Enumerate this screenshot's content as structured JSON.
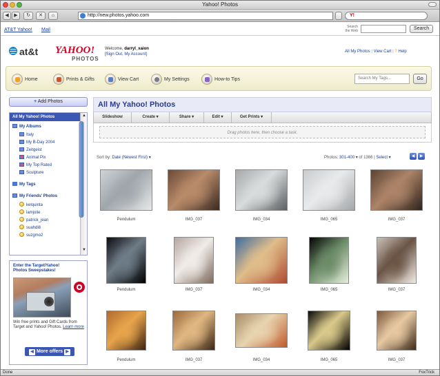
{
  "browser": {
    "window_title": "Yahoo! Photos",
    "url": "http://new.photos.yahoo.com",
    "nav_buttons": [
      "◀",
      "▶",
      "↻",
      "✕",
      "⌂"
    ],
    "search_brand": "Y!",
    "status_left": "Done",
    "status_right": "FoxTrick"
  },
  "toplinks": {
    "att_yahoo": "AT&T Yahoo!",
    "mail": "Mail",
    "search_web_label": "Search the Web",
    "search_button": "Search"
  },
  "header": {
    "att_text": "at&t",
    "yahoo_text": "YAHOO!",
    "photos_text": "PHOTOS",
    "welcome_prefix": "Welcome,",
    "username": "darryl_xaion",
    "signout": "[Sign Out, My Account]",
    "all_my_photos_link": "All My Photos",
    "view_cart_link": "View Cart",
    "help_link": "Help"
  },
  "nav": {
    "items": [
      {
        "label": "Home",
        "icon": "home-icon"
      },
      {
        "label": "Prints & Gifts",
        "icon": "gift-icon"
      },
      {
        "label": "View Cart",
        "icon": "cart-icon"
      },
      {
        "label": "My Settings",
        "icon": "settings-icon"
      },
      {
        "label": "How-to Tips",
        "icon": "tips-icon"
      }
    ],
    "tag_search_placeholder": "Search My Tags...",
    "go_button": "Go"
  },
  "sidebar": {
    "add_photos": "Add Photos",
    "header": "All My Yahoo! Photos",
    "my_albums": "My Albums",
    "albums": [
      "Italy",
      "My B-Day 2004",
      "Zeitgeist",
      "Animal Pix",
      "My Top Rated",
      "Sculpture"
    ],
    "my_tags": "My Tags",
    "my_friends": "My Friends' Photos",
    "friends": [
      "kelquinta",
      "lamjolie",
      "patrick_jean",
      "suahdi8",
      "suzgmo2"
    ]
  },
  "promo": {
    "title": "Enter the Target/Yahoo! Photos Sweepstakes!",
    "body": "Win free prints and Gift Cards from Target and Yahoo! Photos.",
    "learn_more": "Learn more",
    "more_offers": "More offers"
  },
  "main": {
    "title": "All My Yahoo! Photos",
    "actions": [
      "Slideshow",
      "Create ▾",
      "Share ▾",
      "Edit ▾",
      "Get Prints ▾"
    ],
    "drop_text": "Drag photos here, then choose a task.",
    "sort_label": "Sort by:",
    "sort_value": "Date (Newest First) ▾",
    "pager_prefix": "Photos:",
    "pager_range": "301-400 ▾",
    "pager_of": "of 1366 |",
    "select_label": "Select ▾",
    "prev": "◀",
    "next": "▶"
  },
  "photos": [
    {
      "caption": "Pendulum",
      "colors": [
        "#cfd3d6",
        "#9fa6ab",
        "#e7e7e7"
      ],
      "w": 76,
      "h": 60
    },
    {
      "caption": "IMG_037",
      "colors": [
        "#6c4a36",
        "#b98b6a",
        "#3a2a20"
      ],
      "w": 76,
      "h": 60
    },
    {
      "caption": "IMG_034",
      "colors": [
        "#a7a9aa",
        "#d9dcdd",
        "#5c5f61"
      ],
      "w": 76,
      "h": 60
    },
    {
      "caption": "IMG_065",
      "colors": [
        "#c9cbcd",
        "#e9eaeb",
        "#a3a6a9"
      ],
      "w": 76,
      "h": 60
    },
    {
      "caption": "IMG_037",
      "colors": [
        "#5b4334",
        "#ad8468",
        "#2f241d"
      ],
      "w": 76,
      "h": 60
    },
    {
      "caption": "Pendulum",
      "colors": [
        "#0c0d12",
        "#6f7d88",
        "#000000"
      ],
      "w": 58,
      "h": 68
    },
    {
      "caption": "IMG_037",
      "colors": [
        "#b5a89f",
        "#f0ece8",
        "#7d6a5d"
      ],
      "w": 58,
      "h": 68
    },
    {
      "caption": "IMG_034",
      "colors": [
        "#3f6ea0",
        "#e0bd8a",
        "#b04a32"
      ],
      "w": 76,
      "h": 68
    },
    {
      "caption": "IMG_065",
      "colors": [
        "#050505",
        "#6a8a66",
        "#e6eedc"
      ],
      "w": 58,
      "h": 68
    },
    {
      "caption": "IMG_037",
      "colors": [
        "#c9bfb4",
        "#6a5445",
        "#f1ece6"
      ],
      "w": 58,
      "h": 68
    },
    {
      "caption": "Pendulum",
      "colors": [
        "#b06a2d",
        "#e7a44b",
        "#3e2412"
      ],
      "w": 58,
      "h": 58
    },
    {
      "caption": "IMG_037",
      "colors": [
        "#9b6a3f",
        "#e0b781",
        "#3b2616"
      ],
      "w": 62,
      "h": 58
    },
    {
      "caption": "IMG_034",
      "colors": [
        "#a98d6a",
        "#e8d4b0",
        "#c05a2a"
      ],
      "w": 76,
      "h": 50
    },
    {
      "caption": "IMG_065",
      "colors": [
        "#0a0a0a",
        "#d9c98a",
        "#000000"
      ],
      "w": 62,
      "h": 58
    },
    {
      "caption": "IMG_037",
      "colors": [
        "#7d5a3d",
        "#e6c9a2",
        "#3e2a1a"
      ],
      "w": 58,
      "h": 58
    }
  ]
}
